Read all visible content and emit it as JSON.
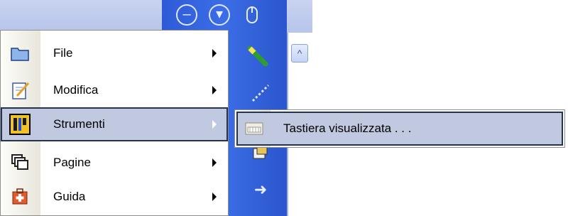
{
  "menu": {
    "items": [
      {
        "label": "File",
        "icon": "folder-icon",
        "has_submenu": true
      },
      {
        "label": "Modifica",
        "icon": "edit-document-icon",
        "has_submenu": true
      },
      {
        "label": "Strumenti",
        "icon": "tools-icon",
        "has_submenu": true,
        "selected": true
      },
      {
        "label": "Pagine",
        "icon": "pages-icon",
        "has_submenu": true
      },
      {
        "label": "Guida",
        "icon": "help-kit-icon",
        "has_submenu": true
      }
    ]
  },
  "submenu": {
    "items": [
      {
        "label": "Tastiera visualizzata . . .",
        "icon": "keyboard-icon"
      }
    ]
  },
  "colors": {
    "toolbar_blue": "#3b6de6",
    "selection_bg": "#c1c9e0",
    "selection_border": "#24344f"
  }
}
